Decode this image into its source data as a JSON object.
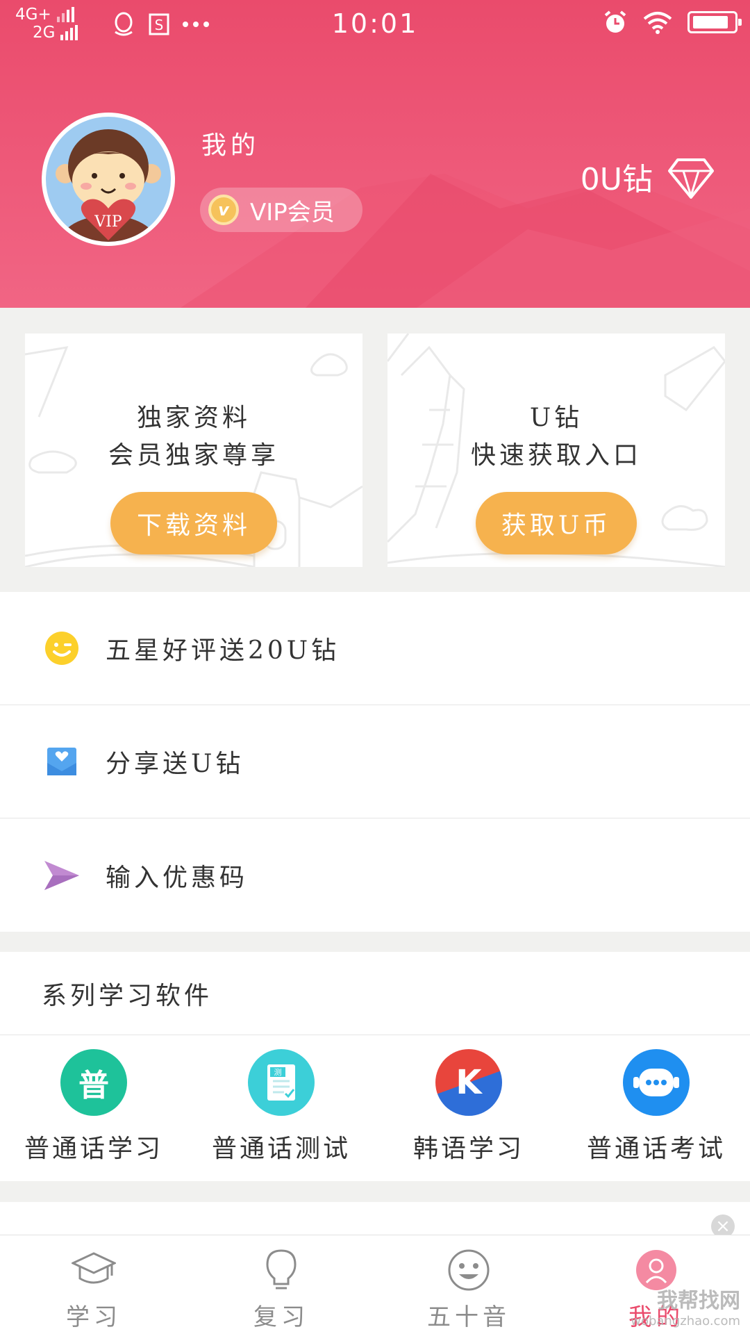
{
  "status_bar": {
    "network_top": "4G+",
    "network_bottom": "2G",
    "time": "10:01"
  },
  "profile": {
    "title": "我的",
    "vip_label": "VIP会员",
    "vip_coin_letter": "v",
    "avatar_badge": "VIP",
    "diamond_count": "0U钻"
  },
  "cards": [
    {
      "line1": "独家资料",
      "line2": "会员独家尊享",
      "button": "下载资料"
    },
    {
      "line1": "U钻",
      "line2": "快速获取入口",
      "button": "获取U币"
    }
  ],
  "menu": [
    {
      "icon": "smiley-icon",
      "label": "五星好评送20U钻"
    },
    {
      "icon": "share-heart-icon",
      "label": "分享送U钻"
    },
    {
      "icon": "paper-plane-icon",
      "label": "输入优惠码"
    }
  ],
  "apps_section": {
    "title": "系列学习软件",
    "apps": [
      {
        "icon": "putonghua-icon",
        "name": "普通话学习",
        "glyph": "普",
        "color": "#1ec29a"
      },
      {
        "icon": "test-doc-icon",
        "name": "普通话测试",
        "glyph": "测",
        "color": "#3ccfd8"
      },
      {
        "icon": "korean-k-icon",
        "name": "韩语学习",
        "glyph": "K",
        "color": "#e8453c"
      },
      {
        "icon": "chat-robot-icon",
        "name": "普通话考试",
        "glyph": "•••",
        "color": "#1f8ff0"
      }
    ]
  },
  "tabbar": [
    {
      "icon": "graduation-cap-icon",
      "label": "学习",
      "active": false
    },
    {
      "icon": "lightbulb-icon",
      "label": "复习",
      "active": false
    },
    {
      "icon": "smile-face-icon",
      "label": "五十音",
      "active": false
    },
    {
      "icon": "user-icon",
      "label": "我的",
      "active": true
    }
  ],
  "watermark": {
    "line1": "我帮找网",
    "line2": "wobangzhao.com"
  },
  "colors": {
    "brand_pink": "#ea4b6c",
    "button_orange": "#f6b24e"
  }
}
